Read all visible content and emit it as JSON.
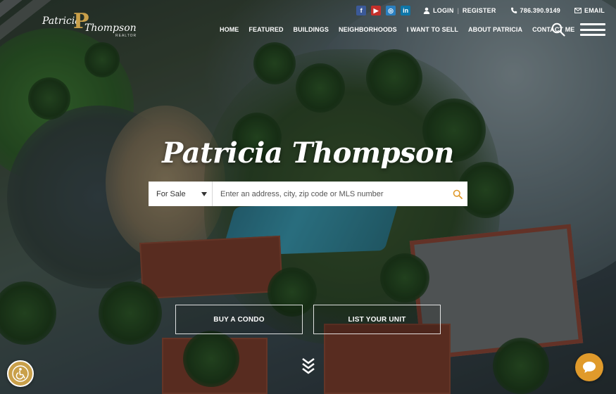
{
  "brand": {
    "first_name": "Patricia",
    "last_name": "Thompson",
    "tagline": "REALTOR",
    "gold": "#c9a04a"
  },
  "social": [
    {
      "name": "facebook-icon",
      "glyph": "f"
    },
    {
      "name": "youtube-icon",
      "glyph": "▶"
    },
    {
      "name": "instagram-icon",
      "glyph": "◎"
    },
    {
      "name": "linkedin-icon",
      "glyph": "in"
    }
  ],
  "topbar": {
    "login": "LOGIN",
    "register": "REGISTER",
    "phone": "786.390.9149",
    "email": "EMAIL"
  },
  "nav": {
    "items": [
      "HOME",
      "FEATURED",
      "BUILDINGS",
      "NEIGHBORHOODS",
      "I WANT TO SELL",
      "ABOUT PATRICIA",
      "CONTACT ME"
    ]
  },
  "hero": {
    "title": "Patricia Thompson",
    "search": {
      "selected": "For Sale",
      "placeholder": "Enter an address, city, zip code or MLS number"
    },
    "buttons": {
      "buy": "BUY A CONDO",
      "list": "LIST YOUR UNIT"
    }
  },
  "colors": {
    "accent": "#e09a2b",
    "accessibility": "#c9a04a"
  }
}
